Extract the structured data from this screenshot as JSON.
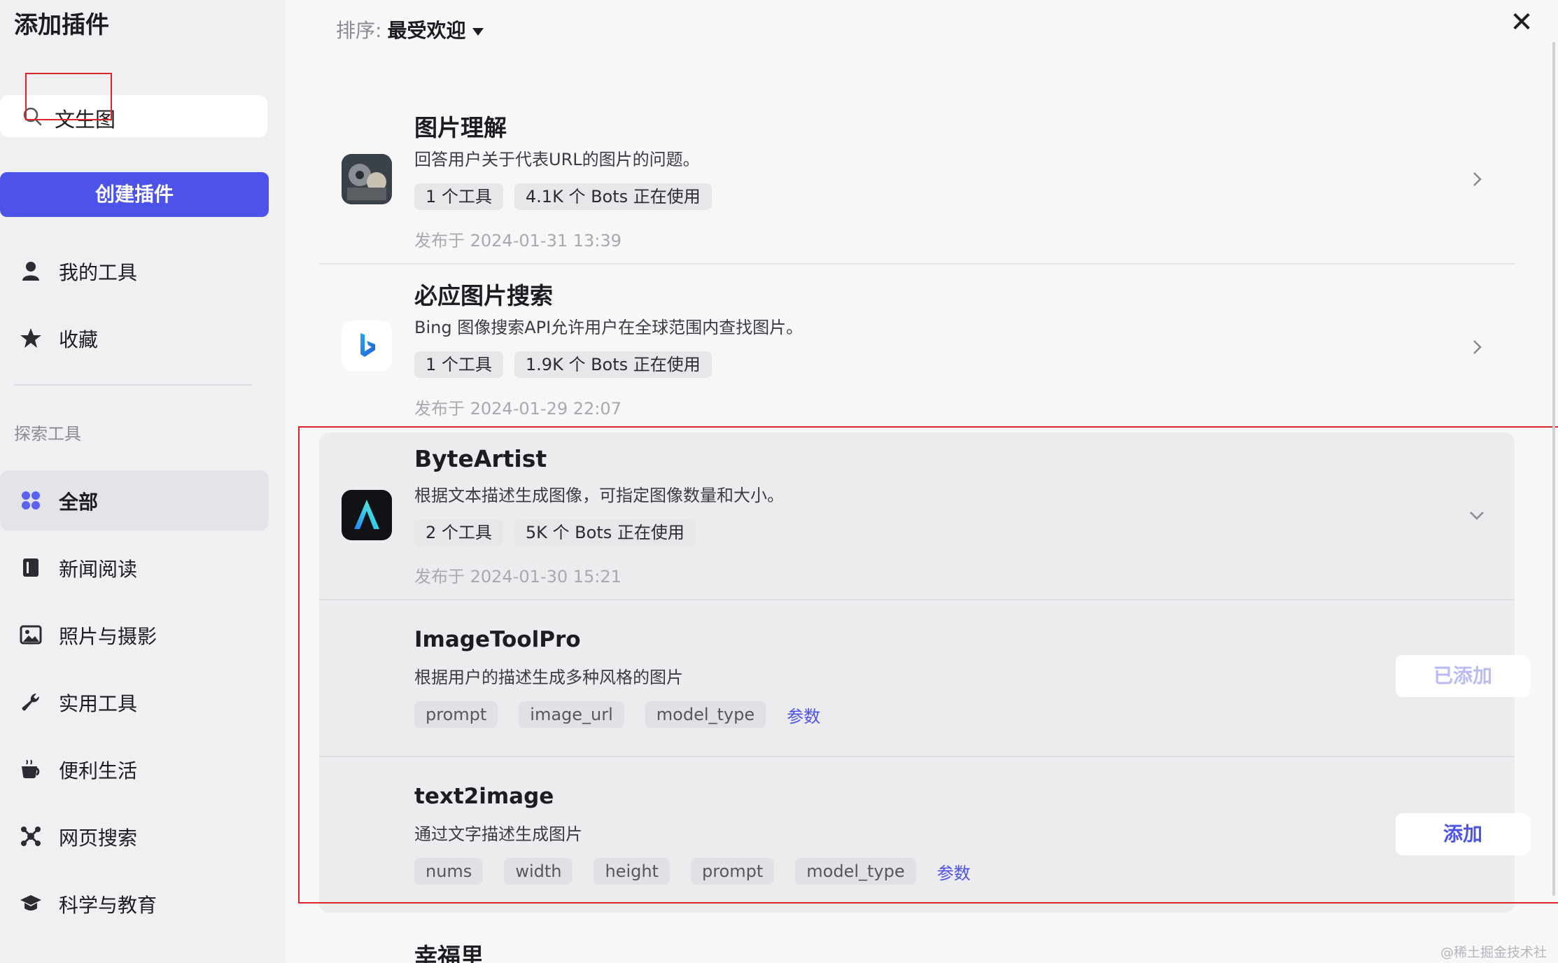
{
  "sidebar": {
    "title": "添加插件",
    "search_value": "文生图",
    "create_label": "创建插件",
    "my_items": [
      {
        "label": "我的工具",
        "icon": "user-icon"
      },
      {
        "label": "收藏",
        "icon": "star-icon"
      }
    ],
    "section_label": "探索工具",
    "categories": [
      {
        "label": "全部",
        "icon": "grid-icon",
        "active": true
      },
      {
        "label": "新闻阅读",
        "icon": "book-icon"
      },
      {
        "label": "照片与摄影",
        "icon": "image-icon"
      },
      {
        "label": "实用工具",
        "icon": "wrench-icon"
      },
      {
        "label": "便利生活",
        "icon": "cup-icon"
      },
      {
        "label": "网页搜索",
        "icon": "network-icon"
      },
      {
        "label": "科学与教育",
        "icon": "graduation-cap-icon"
      }
    ]
  },
  "sort": {
    "label": "排序:",
    "value": "最受欢迎"
  },
  "close_glyph": "✕",
  "plugins": [
    {
      "name": "图片理解",
      "desc": "回答用户关于代表URL的图片的问题。",
      "tools": "1 个工具",
      "bots": "4.1K 个 Bots 正在使用",
      "date": "发布于 2024-01-31 13:39"
    },
    {
      "name": "必应图片搜索",
      "desc": "Bing 图像搜索API允许用户在全球范围内查找图片。",
      "tools": "1 个工具",
      "bots": "1.9K 个 Bots 正在使用",
      "date": "发布于 2024-01-29 22:07"
    },
    {
      "name": "ByteArtist",
      "desc": "根据文本描述生成图像，可指定图像数量和大小。",
      "tools": "2 个工具",
      "bots": "5K 个 Bots 正在使用",
      "date": "发布于 2024-01-30 15:21"
    }
  ],
  "tools": [
    {
      "name": "ImageToolPro",
      "desc": "根据用户的描述生成多种风格的图片",
      "params": [
        "prompt",
        "image_url",
        "model_type"
      ],
      "params_link": "参数",
      "button": "已添加"
    },
    {
      "name": "text2image",
      "desc": "通过文字描述生成图片",
      "params": [
        "nums",
        "width",
        "height",
        "prompt",
        "model_type"
      ],
      "params_link": "参数",
      "button": "添加"
    }
  ],
  "next_plugin_peek": "幸福里",
  "watermark": "@稀土掘金技术社区",
  "colors": {
    "accent": "#4d53e8",
    "annotation": "#d9262c"
  }
}
